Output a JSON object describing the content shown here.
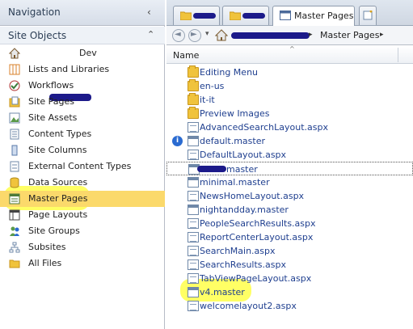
{
  "nav": {
    "title": "Navigation",
    "collapse_glyph": "‹",
    "section_title": "Site Objects",
    "section_glyph": "⌃",
    "items": [
      {
        "label": "Dev",
        "icon": "home-icon",
        "redacted": true
      },
      {
        "label": "Lists and Libraries",
        "icon": "lists-icon"
      },
      {
        "label": "Workflows",
        "icon": "workflow-icon"
      },
      {
        "label": "Site Pages",
        "icon": "site-pages-icon"
      },
      {
        "label": "Site Assets",
        "icon": "site-assets-icon"
      },
      {
        "label": "Content Types",
        "icon": "content-types-icon"
      },
      {
        "label": "Site Columns",
        "icon": "site-columns-icon"
      },
      {
        "label": "External Content Types",
        "icon": "external-content-icon"
      },
      {
        "label": "Data Sources",
        "icon": "data-sources-icon"
      },
      {
        "label": "Master Pages",
        "icon": "master-pages-icon",
        "selected": true
      },
      {
        "label": "Page Layouts",
        "icon": "page-layouts-icon"
      },
      {
        "label": "Site Groups",
        "icon": "site-groups-icon"
      },
      {
        "label": "Subsites",
        "icon": "subsites-icon"
      },
      {
        "label": "All Files",
        "icon": "all-files-icon"
      }
    ]
  },
  "tabs": {
    "active_label": "Master Pages"
  },
  "address": {
    "back": "◄",
    "forward": "►",
    "dropdown": "▾",
    "separator": "▸",
    "crumb": "Master Pages"
  },
  "list": {
    "column_name": "Name",
    "sort_glyph": "^",
    "info_glyph": "i",
    "files": [
      {
        "name": "Editing Menu",
        "type": "folder"
      },
      {
        "name": "en-us",
        "type": "folder"
      },
      {
        "name": "it-it",
        "type": "folder"
      },
      {
        "name": "Preview Images",
        "type": "folder"
      },
      {
        "name": "AdvancedSearchLayout.aspx",
        "type": "page"
      },
      {
        "name": "default.master",
        "type": "master",
        "info": true
      },
      {
        "name": "DefaultLayout.aspx",
        "type": "page"
      },
      {
        "name": "master",
        "type": "master",
        "selected": true,
        "redacted": true
      },
      {
        "name": "minimal.master",
        "type": "master"
      },
      {
        "name": "NewsHomeLayout.aspx",
        "type": "page"
      },
      {
        "name": "nightandday.master",
        "type": "master"
      },
      {
        "name": "PeopleSearchResults.aspx",
        "type": "page"
      },
      {
        "name": "ReportCenterLayout.aspx",
        "type": "page"
      },
      {
        "name": "SearchMain.aspx",
        "type": "page"
      },
      {
        "name": "SearchResults.aspx",
        "type": "page"
      },
      {
        "name": "TabViewPageLayout.aspx",
        "type": "page"
      },
      {
        "name": "v4.master",
        "type": "master"
      },
      {
        "name": "welcomelayout2.aspx",
        "type": "page"
      }
    ]
  },
  "colors": {
    "selection": "#fbd96b",
    "highlighter": "#ffff32",
    "redaction": "#1c1a8a",
    "link": "#1f3f8f"
  }
}
